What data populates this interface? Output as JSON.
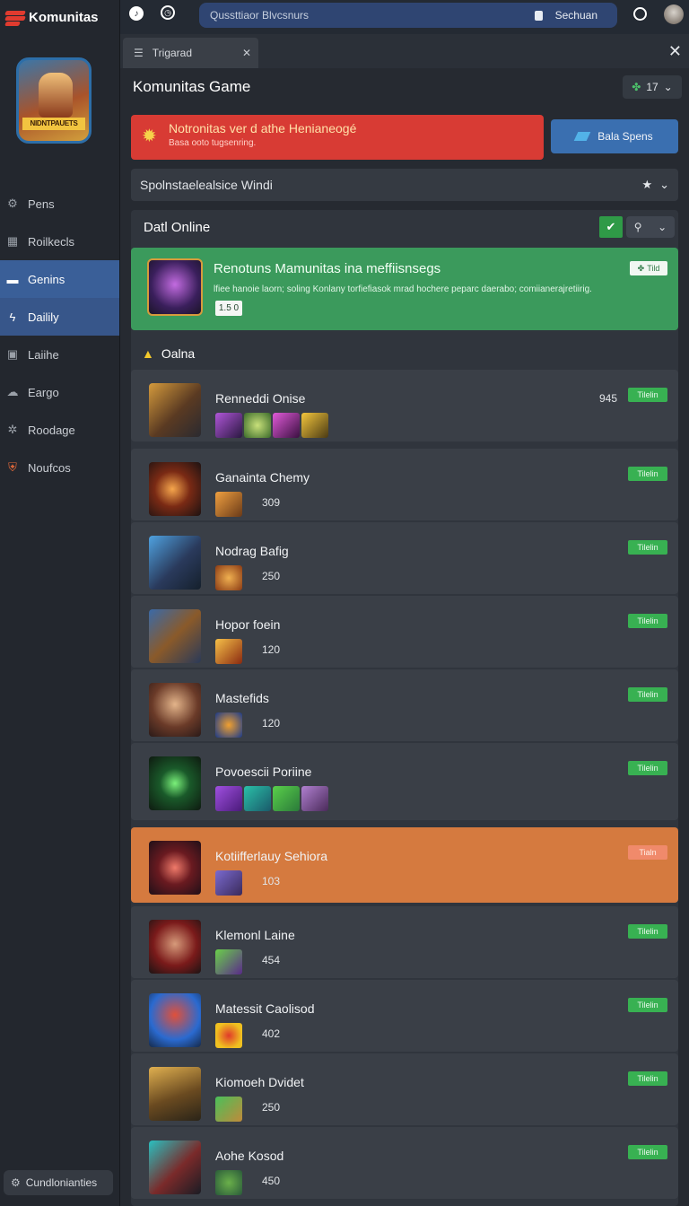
{
  "app": {
    "name": "Komunitas"
  },
  "sidebar": {
    "avatar_banner": "NIDNTPAUETS",
    "items": [
      {
        "label": "Pens",
        "icon": "gear-icon"
      },
      {
        "label": "Roilkecls",
        "icon": "table-icon"
      },
      {
        "label": "Genins",
        "icon": "controller-icon",
        "active": true
      },
      {
        "label": "Dailily",
        "icon": "bolt-icon",
        "active": true
      },
      {
        "label": "Laiihe",
        "icon": "calendar-icon"
      },
      {
        "label": "Eargo",
        "icon": "cloud-icon"
      },
      {
        "label": "Roodage",
        "icon": "cog-icon"
      },
      {
        "label": "Noufcos",
        "icon": "shield-icon"
      }
    ],
    "bottom_button": "Cundlonianties"
  },
  "topbar": {
    "search_text": "Qussttiaor Blvcsnurs",
    "user_label": "Sechuan"
  },
  "tab": {
    "label": "Trigarad"
  },
  "main": {
    "title": "Komunitas Game",
    "online_count": "17",
    "notice": {
      "title": "Notronitas ver d athe Henianeogé",
      "subtitle": "Basa ooto tugsenring.",
      "button": "Bala Spens"
    },
    "filter_label": "Spolnstaelealsice Windi",
    "panel": {
      "title": "Datl Online",
      "featured": {
        "name": "Renotuns Mamunitas ina meffiisnsegs",
        "desc": "lfiee hanoie laorn; soling Konlany torfiefiasok mrad hochere peparc daerabo;  comiianerajretiirig.",
        "value": "1.5 0",
        "badge": "Tild"
      },
      "section_label": "Oalna",
      "rows": [
        {
          "name": "Renneddi Onise",
          "count": "",
          "aux": "945",
          "status": "Tilelin",
          "theme": "default"
        },
        {
          "name": "Ganainta Chemy",
          "count": "309",
          "aux": "",
          "status": "Tilelin",
          "theme": "default"
        },
        {
          "name": "Nodrag Bafig",
          "count": "250",
          "aux": "",
          "status": "Tilelin",
          "theme": "default"
        },
        {
          "name": "Hopor foein",
          "count": "120",
          "aux": "",
          "status": "Tilelin",
          "theme": "default"
        },
        {
          "name": "Mastefids",
          "count": "120",
          "aux": "",
          "status": "Tilelin",
          "theme": "default"
        },
        {
          "name": "Povoescii Poriine",
          "count": "",
          "aux": "",
          "status": "Tilelin",
          "theme": "default"
        },
        {
          "name": "Kotiifferlauy Sehiora",
          "count": "103",
          "aux": "",
          "status": "Tialn",
          "theme": "orange"
        },
        {
          "name": "Klemonl Laine",
          "count": "454",
          "aux": "",
          "status": "Tilelin",
          "theme": "default"
        },
        {
          "name": "Matessit Caolisod",
          "count": "402",
          "aux": "",
          "status": "Tilelin",
          "theme": "default"
        },
        {
          "name": "Kiomoeh Dvidet",
          "count": "250",
          "aux": "",
          "status": "Tilelin",
          "theme": "default"
        },
        {
          "name": "Aohe Kosod",
          "count": "450",
          "aux": "",
          "status": "Tilelin",
          "theme": "default"
        }
      ]
    }
  },
  "colors": {
    "accent": "#3a5f98",
    "notice_red": "#d83b34",
    "featured_green": "#3b9a5c",
    "highlight_orange": "#d57a3f",
    "status_green": "#38b152"
  }
}
